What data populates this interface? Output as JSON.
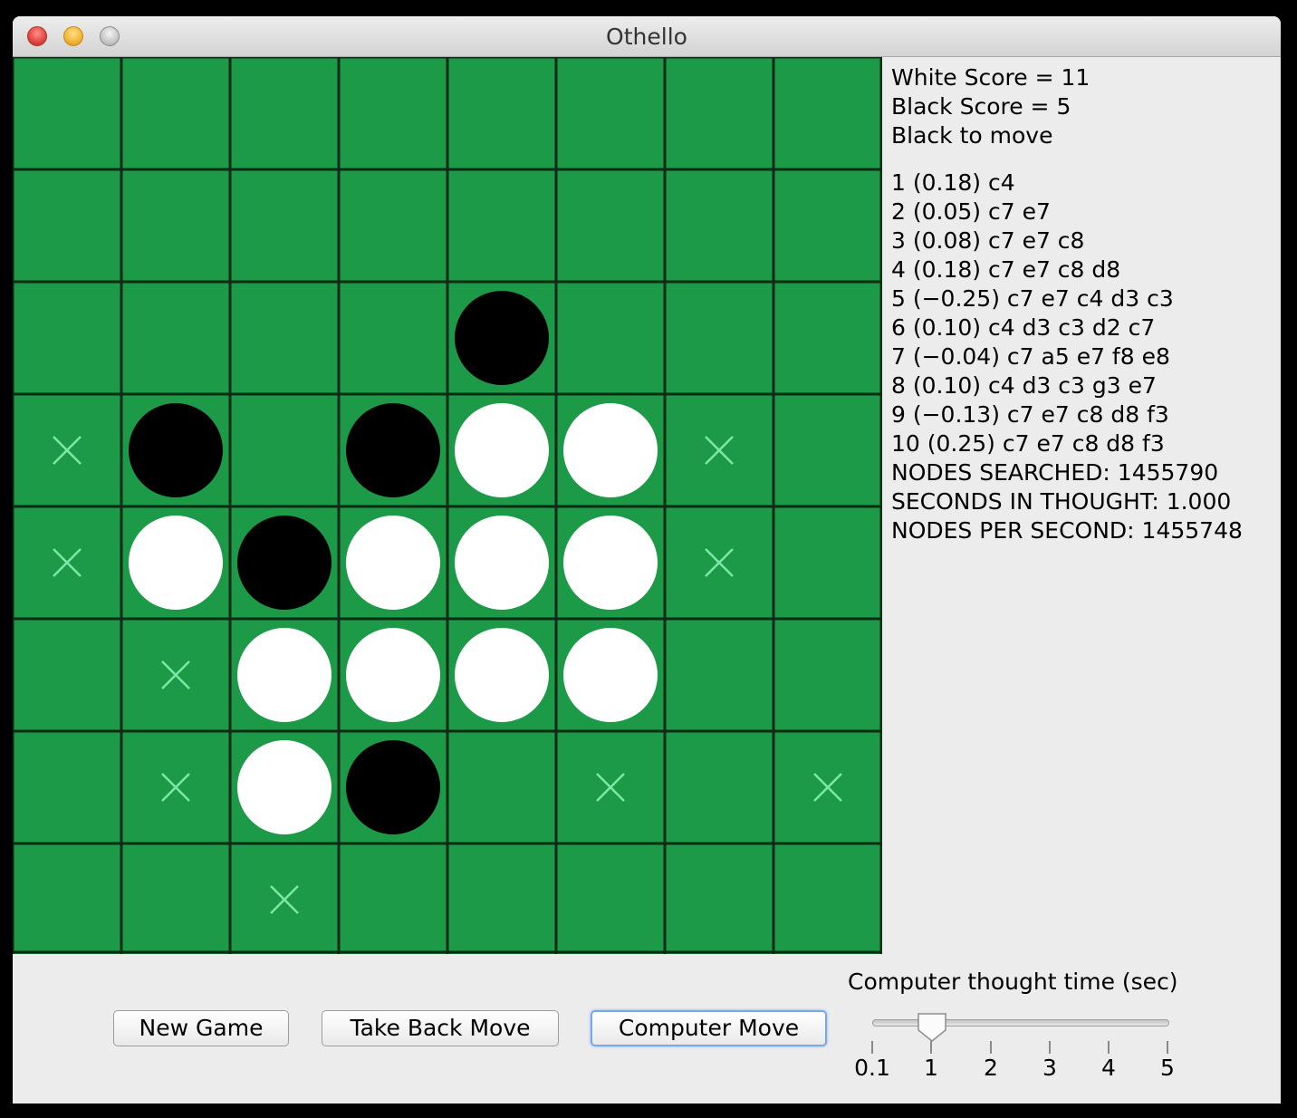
{
  "window": {
    "title": "Othello"
  },
  "board": {
    "size": 8,
    "cells": [
      "........",
      "........",
      "....B...",
      "xB.BWWx.",
      "xWBWWWx.",
      ".xWWWW..",
      ".xWB.x.x.",
      "..x....."
    ],
    "legend": {
      "B": "black",
      "W": "white",
      "x": "legal-move-marker",
      ".": "empty"
    },
    "colors": {
      "felt": "#1d9a48",
      "grid": "#0f2a15",
      "marker": "#7de8a6",
      "black": "#000000",
      "white": "#ffffff"
    }
  },
  "info": {
    "white_score": "White Score = 11",
    "black_score": "Black Score = 5",
    "to_move": "Black to move",
    "lines": [
      "1 (0.18) c4",
      "2 (0.05) c7 e7",
      "3 (0.08) c7 e7 c8",
      "4 (0.18) c7 e7 c8 d8",
      "5 (−0.25) c7 e7 c4 d3 c3",
      "6 (0.10) c4 d3 c3 d2 c7",
      "7 (−0.04) c7 a5 e7 f8 e8",
      "8 (0.10) c4 d3 c3 g3 e7",
      "9 (−0.13) c7 e7 c8 d8 f3",
      "10 (0.25) c7 e7 c8 d8 f3",
      "NODES SEARCHED: 1455790",
      "SECONDS IN THOUGHT: 1.000",
      "NODES PER SECOND: 1455748"
    ]
  },
  "buttons": {
    "new_game": "New Game",
    "take_back": "Take Back Move",
    "computer_move": "Computer Move"
  },
  "slider": {
    "label": "Computer thought time (sec)",
    "ticks": [
      "0.1",
      "1",
      "2",
      "3",
      "4",
      "5"
    ],
    "value": "1"
  }
}
